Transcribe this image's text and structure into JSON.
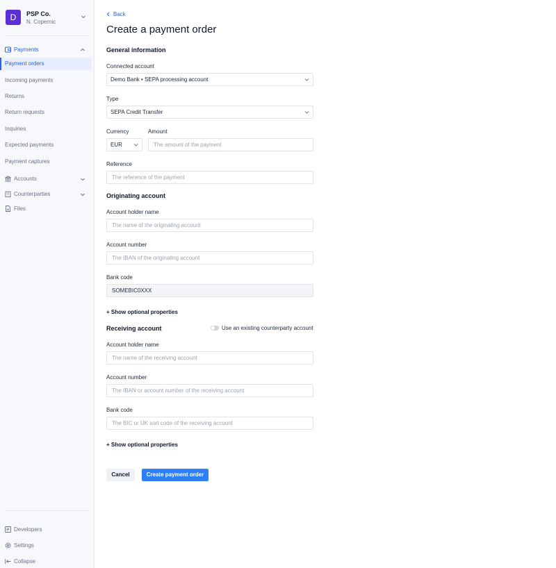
{
  "org": {
    "initial": "D",
    "name": "PSP Co.",
    "user": "N. Copernic"
  },
  "nav": {
    "payments_label": "Payments",
    "items": [
      {
        "label": "Payment orders",
        "active": true
      },
      {
        "label": "Incoming payments"
      },
      {
        "label": "Returns"
      },
      {
        "label": "Return requests"
      },
      {
        "label": "Inquiries"
      },
      {
        "label": "Expected payments"
      },
      {
        "label": "Payment captures"
      }
    ],
    "accounts_label": "Accounts",
    "counterparties_label": "Counterparties",
    "files_label": "Files",
    "developers_label": "Developers",
    "settings_label": "Settings",
    "collapse_label": "Collapse"
  },
  "page": {
    "back_label": "Back",
    "title": "Create a payment order"
  },
  "general": {
    "heading": "General information",
    "connected_account_label": "Connected account",
    "connected_account_value": "Demo Bank • SEPA processing account",
    "type_label": "Type",
    "type_value": "SEPA Credit Transfer",
    "currency_label": "Currency",
    "currency_value": "EUR",
    "amount_label": "Amount",
    "amount_placeholder": "The amount of the payment",
    "reference_label": "Reference",
    "reference_placeholder": "The reference of the payment"
  },
  "originating": {
    "heading": "Originating account",
    "holder_label": "Account holder name",
    "holder_placeholder": "The name of the originating account",
    "number_label": "Account number",
    "number_placeholder": "The IBAN of the originating account",
    "bank_code_label": "Bank code",
    "bank_code_value": "SOMEBIC0XXX",
    "optional_link": "+ Show optional properties"
  },
  "receiving": {
    "heading": "Receiving account",
    "toggle_label": "Use an existing counterparty account",
    "holder_label": "Account holder name",
    "holder_placeholder": "The name of the receiving account",
    "number_label": "Account number",
    "number_placeholder": "The IBAN or account number of the receiving account",
    "bank_code_label": "Bank code",
    "bank_code_placeholder": "The BIC or UK sort code of the receiving account",
    "optional_link": "+ Show optional properties"
  },
  "actions": {
    "cancel_label": "Cancel",
    "create_label": "Create payment order"
  },
  "colors": {
    "accent": "#2563eb",
    "primary_button": "#2d7ff9",
    "org_logo": "#5b2fd6"
  }
}
